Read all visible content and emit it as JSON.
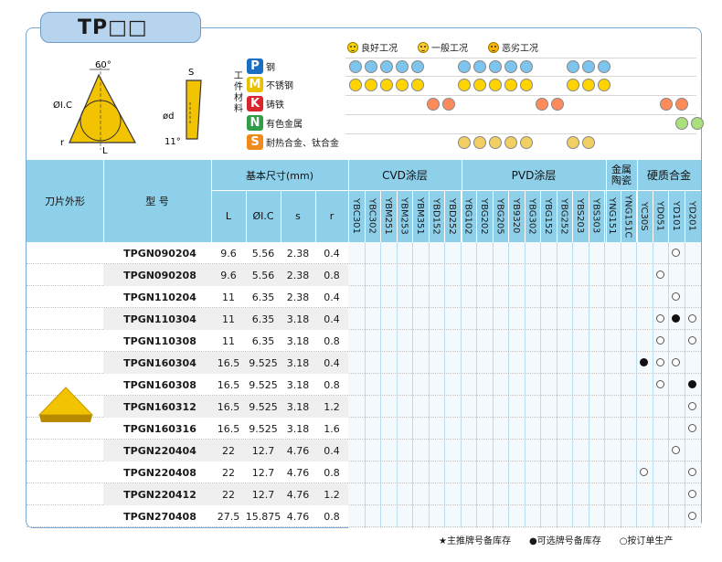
{
  "title": "TP□□",
  "legend": {
    "good": "良好工况",
    "general": "一般工况",
    "bad": "恶劣工况"
  },
  "diagram": {
    "angle": "60°",
    "ic": "ØI.C",
    "r": "r",
    "L": "L",
    "S": "S",
    "d": "ød",
    "relief": "11°"
  },
  "material_label": "工件材料",
  "materials": [
    {
      "letter": "P",
      "name": "钢",
      "color": "#1a6fc2"
    },
    {
      "letter": "M",
      "name": "不锈钢",
      "color": "#e8c200"
    },
    {
      "letter": "K",
      "name": "铸铁",
      "color": "#d8262c"
    },
    {
      "letter": "N",
      "name": "有色金属",
      "color": "#2f9e46"
    },
    {
      "letter": "S",
      "name": "耐热合金、钛合金",
      "color": "#f08a1c"
    }
  ],
  "headers": {
    "shape": "刀片外形",
    "model": "型 号",
    "dims": "基本尺寸(mm)",
    "L": "L",
    "IC": "ØI.C",
    "s": "s",
    "r": "r",
    "cvd": "CVD涂层",
    "pvd": "PVD涂层",
    "cermet": "金属陶瓷",
    "carbide": "硬质合金"
  },
  "grades": [
    "YBC301",
    "YBC302",
    "YBM251",
    "YBM253",
    "YBM351",
    "YBD152",
    "YBD252",
    "YBG102",
    "YBG202",
    "YBG205",
    "YB9320",
    "YBG302",
    "YBG152",
    "YBG252",
    "YBS203",
    "YBS303",
    "YNG151",
    "YNG151C",
    "YC30S",
    "YD051",
    "YD101",
    "YD201"
  ],
  "rows": [
    {
      "model": "TPGN090204",
      "L": "9.6",
      "IC": "5.56",
      "s": "2.38",
      "r": "0.4"
    },
    {
      "model": "TPGN090208",
      "L": "9.6",
      "IC": "5.56",
      "s": "2.38",
      "r": "0.8"
    },
    {
      "model": "TPGN110204",
      "L": "11",
      "IC": "6.35",
      "s": "2.38",
      "r": "0.4"
    },
    {
      "model": "TPGN110304",
      "L": "11",
      "IC": "6.35",
      "s": "3.18",
      "r": "0.4"
    },
    {
      "model": "TPGN110308",
      "L": "11",
      "IC": "6.35",
      "s": "3.18",
      "r": "0.8"
    },
    {
      "model": "TPGN160304",
      "L": "16.5",
      "IC": "9.525",
      "s": "3.18",
      "r": "0.4"
    },
    {
      "model": "TPGN160308",
      "L": "16.5",
      "IC": "9.525",
      "s": "3.18",
      "r": "0.8"
    },
    {
      "model": "TPGN160312",
      "L": "16.5",
      "IC": "9.525",
      "s": "3.18",
      "r": "1.2"
    },
    {
      "model": "TPGN160316",
      "L": "16.5",
      "IC": "9.525",
      "s": "3.18",
      "r": "1.6"
    },
    {
      "model": "TPGN220404",
      "L": "22",
      "IC": "12.7",
      "s": "4.76",
      "r": "0.4"
    },
    {
      "model": "TPGN220408",
      "L": "22",
      "IC": "12.7",
      "s": "4.76",
      "r": "0.8"
    },
    {
      "model": "TPGN220412",
      "L": "22",
      "IC": "12.7",
      "s": "4.76",
      "r": "1.2"
    },
    {
      "model": "TPGN270408",
      "L": "27.5",
      "IC": "15.875",
      "s": "4.76",
      "r": "0.8"
    }
  ],
  "footer": {
    "star": "★主推牌号备库存",
    "dot": "●可选牌号备库存",
    "circle": "○按订单生产"
  }
}
